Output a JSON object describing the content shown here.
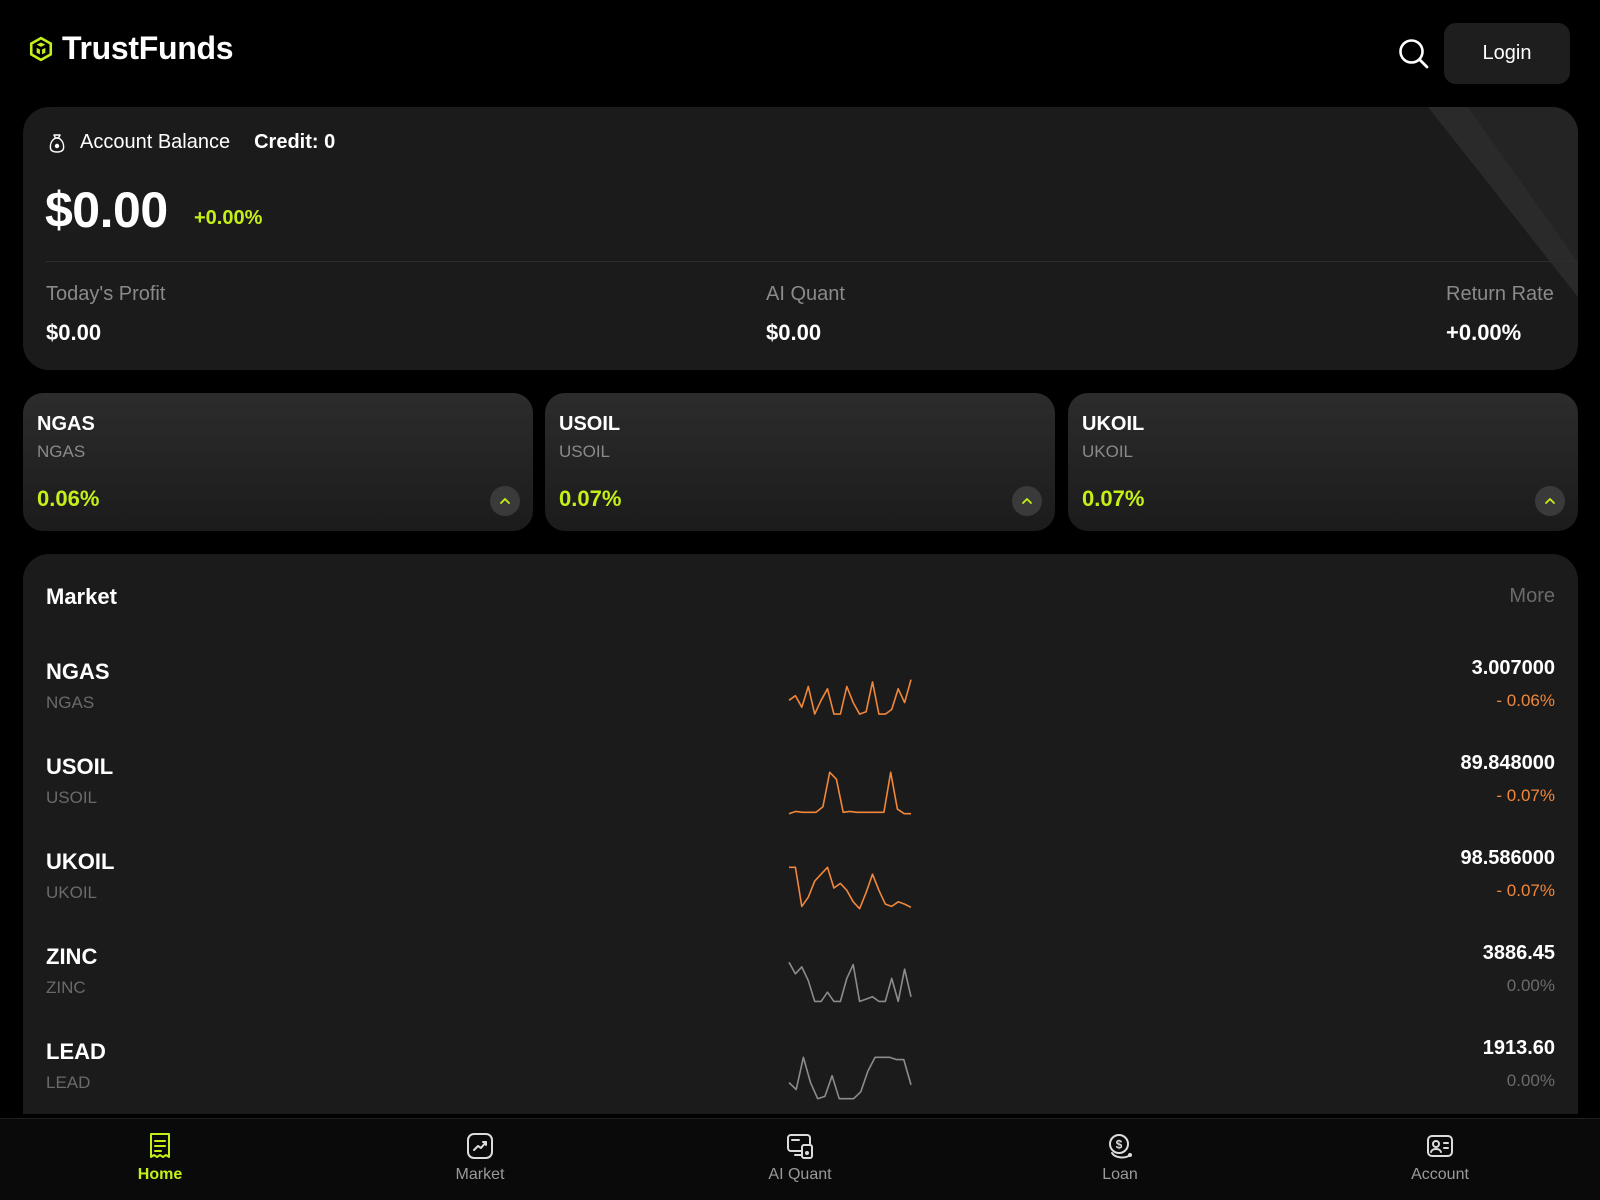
{
  "header": {
    "brand": "TrustFunds",
    "login_label": "Login"
  },
  "balance": {
    "label": "Account Balance",
    "credit": "Credit: 0",
    "amount": "$0.00",
    "change": "+0.00%",
    "stats": [
      {
        "label": "Today's Profit",
        "value": "$0.00"
      },
      {
        "label": "AI Quant",
        "value": "$0.00"
      },
      {
        "label": "Return Rate",
        "value": "+0.00%"
      }
    ]
  },
  "tickers": [
    {
      "name": "NGAS",
      "sub": "NGAS",
      "pct": "0.06%"
    },
    {
      "name": "USOIL",
      "sub": "USOIL",
      "pct": "0.07%"
    },
    {
      "name": "UKOIL",
      "sub": "UKOIL",
      "pct": "0.07%"
    }
  ],
  "market": {
    "title": "Market",
    "more": "More",
    "rows": [
      {
        "name": "NGAS",
        "sub": "NGAS",
        "price": "3.007000",
        "change": "- 0.06%",
        "trend": "down",
        "spark": [
          0.55,
          0.45,
          0.7,
          0.25,
          0.85,
          0.55,
          0.3,
          0.85,
          0.85,
          0.25,
          0.6,
          0.85,
          0.8,
          0.15,
          0.85,
          0.85,
          0.75,
          0.3,
          0.6,
          0.1
        ]
      },
      {
        "name": "USOIL",
        "sub": "USOIL",
        "price": "89.848000",
        "change": "- 0.07%",
        "trend": "down",
        "spark": [
          0.95,
          0.9,
          0.92,
          0.92,
          0.92,
          0.8,
          0.05,
          0.2,
          0.92,
          0.9,
          0.92,
          0.92,
          0.92,
          0.92,
          0.92,
          0.05,
          0.85,
          0.95,
          0.95
        ]
      },
      {
        "name": "UKOIL",
        "sub": "UKOIL",
        "price": "98.586000",
        "change": "- 0.07%",
        "trend": "down",
        "spark": [
          0.05,
          0.05,
          0.9,
          0.7,
          0.35,
          0.2,
          0.05,
          0.5,
          0.4,
          0.55,
          0.8,
          0.95,
          0.6,
          0.2,
          0.55,
          0.85,
          0.9,
          0.8,
          0.85,
          0.92
        ]
      },
      {
        "name": "ZINC",
        "sub": "ZINC",
        "price": "3886.45",
        "change": "0.00%",
        "trend": "flat",
        "spark": [
          0.05,
          0.3,
          0.15,
          0.45,
          0.9,
          0.9,
          0.7,
          0.9,
          0.9,
          0.4,
          0.1,
          0.9,
          0.85,
          0.8,
          0.9,
          0.9,
          0.4,
          0.9,
          0.2,
          0.8
        ]
      },
      {
        "name": "LEAD",
        "sub": "LEAD",
        "price": "1913.60",
        "change": "0.00%",
        "trend": "flat",
        "spark": [
          0.6,
          0.75,
          0.05,
          0.6,
          0.95,
          0.9,
          0.45,
          0.95,
          0.95,
          0.95,
          0.8,
          0.35,
          0.05,
          0.05,
          0.05,
          0.1,
          0.1,
          0.65
        ]
      }
    ]
  },
  "nav": [
    {
      "label": "Home",
      "icon": "home-icon",
      "active": true
    },
    {
      "label": "Market",
      "icon": "market-icon",
      "active": false
    },
    {
      "label": "AI Quant",
      "icon": "ai-quant-icon",
      "active": false
    },
    {
      "label": "Loan",
      "icon": "loan-icon",
      "active": false
    },
    {
      "label": "Account",
      "icon": "account-icon",
      "active": false
    }
  ],
  "colors": {
    "accent": "#c4f018",
    "down": "#f0873a",
    "flat": "#8c8c8c",
    "card": "#1b1b1b",
    "background": "#000000"
  }
}
